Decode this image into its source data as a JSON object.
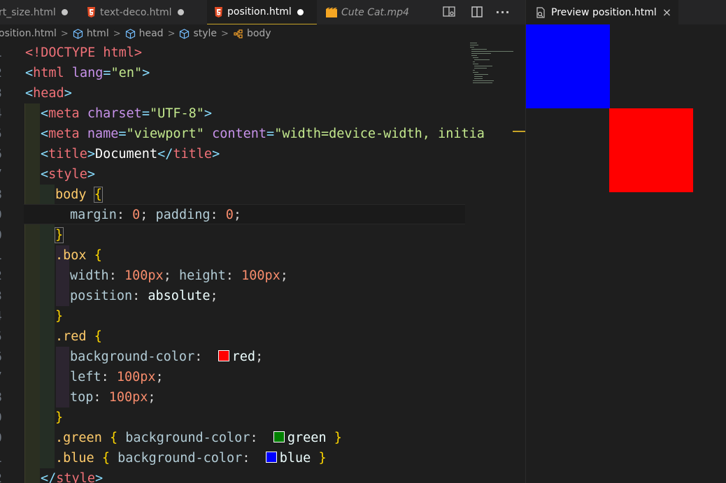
{
  "tabs": [
    {
      "name": "rt_size.html",
      "state": "modified"
    },
    {
      "name": "text-deco.html",
      "state": "modified"
    },
    {
      "name": "position.html",
      "state": "active-modified"
    },
    {
      "name": "Cute Cat.mp4",
      "state": "preview"
    }
  ],
  "toolbar_icons": [
    "open-preview-icon",
    "split-editor-icon",
    "more-actions-icon"
  ],
  "toolbar_more": "···",
  "breadcrumb": {
    "items": [
      "osition.html",
      "html",
      "head",
      "style",
      "body"
    ]
  },
  "preview": {
    "tab_title": "Preview position.html",
    "close": "×",
    "boxes": [
      {
        "color": "#0000ff",
        "label": "blue"
      },
      {
        "color": "#ff0000",
        "label": "red"
      }
    ]
  },
  "colors": {
    "accent_yellow": "#c8a427",
    "html5_orange": "#e44d26",
    "video_orange": "#f5a623"
  },
  "code": {
    "line_numbers": [
      "1",
      "2",
      "3",
      "4",
      "5",
      "6",
      "7",
      "8",
      "9",
      "0",
      "1",
      "2",
      "3",
      "4",
      "5",
      "6",
      "7",
      "8",
      "9",
      "0",
      "1",
      "2"
    ],
    "doctype": "<!DOCTYPE html>",
    "html_open_tag": "html",
    "lang_attr": "lang",
    "lang_val": "\"en\"",
    "head_tag": "head",
    "meta_tag": "meta",
    "charset_attr": "charset",
    "charset_val": "\"UTF-8\"",
    "name_attr": "name",
    "name_val": "\"viewport\"",
    "content_attr": "content",
    "content_val": "\"width=device-width, initia",
    "title_tag": "title",
    "title_text": "Document",
    "style_tag": "style",
    "body_sel": "body",
    "margin_prop": "margin",
    "margin_val": "0",
    "padding_prop": "padding",
    "padding_val": "0",
    "box_sel": ".box",
    "width_prop": "width",
    "width_val": "100px",
    "height_prop": "height",
    "height_val": "100px",
    "position_prop": "position",
    "position_val": "absolute",
    "red_sel": ".red",
    "bgc_prop": "background-color",
    "red_val": "red",
    "left_prop": "left",
    "left_val": "100px",
    "top_prop": "top",
    "top_val": "100px",
    "green_sel": ".green",
    "green_val": "green",
    "blue_sel": ".blue",
    "blue_val": "blue"
  }
}
